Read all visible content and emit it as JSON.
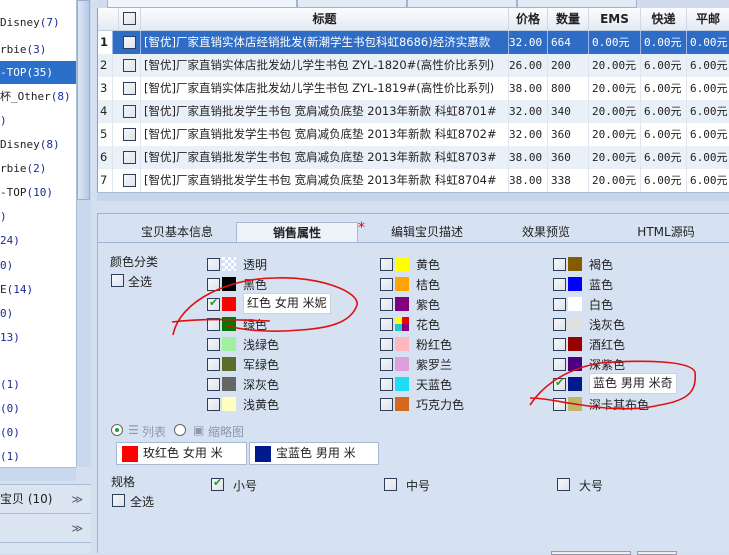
{
  "sidebar": {
    "items": [
      {
        "label": "Disney",
        "count": "(7)"
      },
      {
        "label": "rbie",
        "count": "(3)"
      },
      {
        "label": "-TOP",
        "count": "(35)",
        "selected": true
      },
      {
        "label": "杯_Other",
        "count": "(8)"
      },
      {
        "label": "",
        "count": ")"
      },
      {
        "label": "Disney",
        "count": "(8)"
      },
      {
        "label": "rbie",
        "count": "(2)"
      },
      {
        "label": "-TOP",
        "count": "(10)"
      },
      {
        "label": "",
        "count": ")"
      },
      {
        "label": "",
        "count": "24)"
      },
      {
        "label": "",
        "count": "0)"
      },
      {
        "label": "E",
        "count": "(14)"
      },
      {
        "label": "",
        "count": "0)"
      },
      {
        "label": "",
        "count": "13)"
      },
      {
        "label": "",
        "count": ""
      },
      {
        "label": "",
        "count": "(1)"
      },
      {
        "label": "",
        "count": "(0)"
      },
      {
        "label": "",
        "count": "(0)"
      },
      {
        "label": "",
        "count": "(1)"
      }
    ],
    "accordion": [
      {
        "label": "宝贝 (10)"
      },
      {
        "label": ""
      }
    ]
  },
  "grid": {
    "columns": [
      "标题",
      "价格",
      "数量",
      "EMS",
      "快递",
      "平邮"
    ],
    "rows": [
      {
        "n": "1",
        "title": "[智优]厂家直销实体店经销批发(新潮学生书包科虹8686)经济实惠款",
        "price": "32.00",
        "qty": "664",
        "ems": "0.00元",
        "express": "0.00元",
        "mail": "0.00元"
      },
      {
        "n": "2",
        "title": "[智优]厂家直销实体店批发幼儿学生书包 ZYL-1820#(高性价比系列)",
        "price": "26.00",
        "qty": "200",
        "ems": "20.00元",
        "express": "6.00元",
        "mail": "6.00元"
      },
      {
        "n": "3",
        "title": "[智优]厂家直销实体店批发幼儿学生书包 ZYL-1819#(高性价比系列)",
        "price": "38.00",
        "qty": "800",
        "ems": "20.00元",
        "express": "6.00元",
        "mail": "6.00元"
      },
      {
        "n": "4",
        "title": "[智优]厂家直销批发学生书包 宽肩减负底垫 2013年新款 科虹8701#",
        "price": "32.00",
        "qty": "340",
        "ems": "20.00元",
        "express": "6.00元",
        "mail": "6.00元"
      },
      {
        "n": "5",
        "title": "[智优]厂家直销批发学生书包 宽肩减负底垫 2013年新款 科虹8702#",
        "price": "32.00",
        "qty": "360",
        "ems": "20.00元",
        "express": "6.00元",
        "mail": "6.00元"
      },
      {
        "n": "6",
        "title": "[智优]厂家直销批发学生书包 宽肩减负底垫 2013年新款 科虹8703#",
        "price": "38.00",
        "qty": "360",
        "ems": "20.00元",
        "express": "6.00元",
        "mail": "6.00元"
      },
      {
        "n": "7",
        "title": "[智优]厂家直销批发学生书包 宽肩减负底垫 2013年新款 科虹8704#",
        "price": "38.00",
        "qty": "338",
        "ems": "20.00元",
        "express": "6.00元",
        "mail": "6.00元"
      }
    ]
  },
  "tabs": [
    "宝贝基本信息",
    "销售属性",
    "编辑宝贝描述",
    "效果预览",
    "HTML源码"
  ],
  "required_mark": "*",
  "color": {
    "label": "颜色分类",
    "select_all": "全选",
    "options": [
      [
        {
          "name": "透明",
          "swatch": "transparent"
        },
        {
          "name": "黑色",
          "swatch": "#000000"
        },
        {
          "name": "红色 女用 米妮",
          "swatch": "#ff0000",
          "checked": true,
          "editable": true
        },
        {
          "name": "绿色",
          "swatch": "#007a00"
        },
        {
          "name": "浅绿色",
          "swatch": "#a0f0a0"
        },
        {
          "name": "军绿色",
          "swatch": "#5a6e2a"
        },
        {
          "name": "深灰色",
          "swatch": "#666666"
        },
        {
          "name": "浅黄色",
          "swatch": "#ffffbf"
        }
      ],
      [
        {
          "name": "黄色",
          "swatch": "#ffff00"
        },
        {
          "name": "桔色",
          "swatch": "#ffa500"
        },
        {
          "name": "紫色",
          "swatch": "#800080"
        },
        {
          "name": "花色",
          "swatch": "multi"
        },
        {
          "name": "粉红色",
          "swatch": "#ffb6c1"
        },
        {
          "name": "紫罗兰",
          "swatch": "#dda0dd"
        },
        {
          "name": "天蓝色",
          "swatch": "#1edcf8"
        },
        {
          "name": "巧克力色",
          "swatch": "#d2691e"
        }
      ],
      [
        {
          "name": "褐色",
          "swatch": "#855b00"
        },
        {
          "name": "蓝色",
          "swatch": "#0000ff"
        },
        {
          "name": "白色",
          "swatch": "#ffffff"
        },
        {
          "name": "浅灰色",
          "swatch": "#e0e0e0"
        },
        {
          "name": "酒红色",
          "swatch": "#990000"
        },
        {
          "name": "深紫色",
          "swatch": "#4b0082"
        },
        {
          "name": "蓝色 男用 米奇",
          "swatch": "#001a8c",
          "checked": true,
          "editable": true
        },
        {
          "name": "深卡其布色",
          "swatch": "#bdb76b"
        }
      ]
    ],
    "view_list": "列表",
    "view_thumb": "缩略图",
    "chips": [
      {
        "text": "玫红色 女用 米",
        "swatch": "#ff0000"
      },
      {
        "text": "宝蓝色 男用 米",
        "swatch": "#001a8c"
      }
    ]
  },
  "size": {
    "label": "规格",
    "select_all": "全选",
    "options": [
      {
        "name": "小号",
        "checked": true
      },
      {
        "name": "中号",
        "checked": false
      },
      {
        "name": "大号",
        "checked": false
      }
    ]
  },
  "annotation_color": "#e01010"
}
